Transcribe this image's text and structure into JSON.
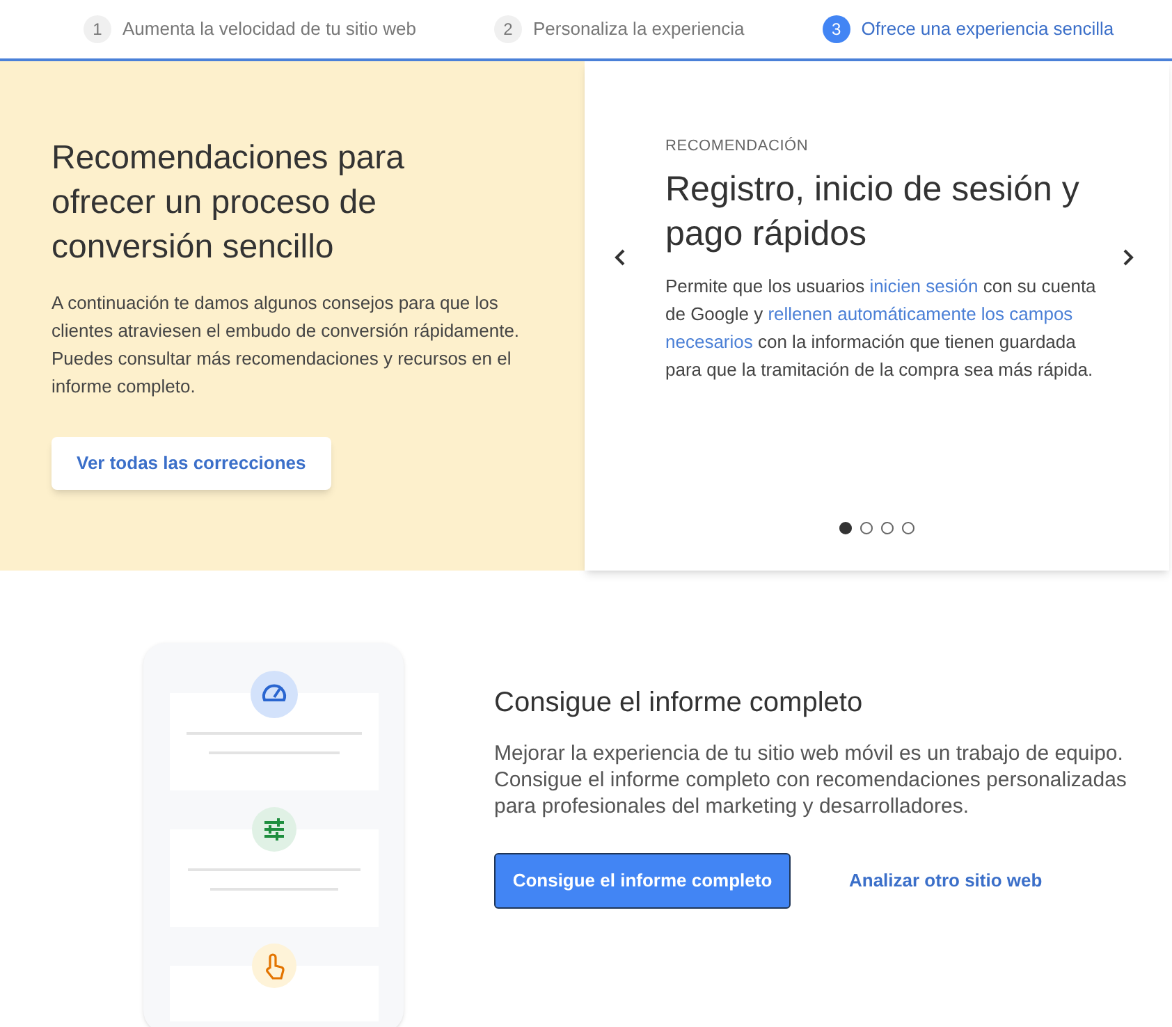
{
  "steps": [
    {
      "number": "1",
      "label": "Aumenta la velocidad de tu sitio web",
      "selected": false
    },
    {
      "number": "2",
      "label": "Personaliza la experiencia",
      "selected": false
    },
    {
      "number": "3",
      "label": "Ofrece una experiencia sencilla",
      "selected": true
    }
  ],
  "intro": {
    "title": "Recomendaciones para ofrecer un proceso de conversión sencillo",
    "text": "A continuación te damos algunos consejos para que los clientes atraviesen el embudo de conversión rápidamente. Puedes consultar más recomendaciones y recursos en el informe completo.",
    "button": "Ver todas las correcciones"
  },
  "recommendation": {
    "eyebrow": "RECOMENDACIÓN",
    "title": "Registro, inicio de sesión y pago rápidos",
    "segments": [
      {
        "kind": "text",
        "text": "Permite que los usuarios "
      },
      {
        "kind": "link",
        "text": "inicien sesión"
      },
      {
        "kind": "text",
        "text": " con su cuenta de Google y "
      },
      {
        "kind": "link",
        "text": "rellenen automáticamente los campos "
      },
      {
        "kind": "link",
        "text": "necesarios"
      },
      {
        "kind": "text",
        "text": " con la información que tienen guardada para que la tramitación de la compra sea más rápida."
      }
    ],
    "dots": [
      {
        "selected": true
      },
      {
        "selected": false
      },
      {
        "selected": false
      },
      {
        "selected": false
      }
    ]
  },
  "report": {
    "title": "Consigue el informe completo",
    "text": "Mejorar la experiencia de tu sitio web móvil es un trabajo de equipo. Consigue el informe completo con recomendaciones personalizadas para profesionales del marketing y desarrolladores.",
    "primary_button": "Consigue el informe completo",
    "link": "Analizar otro sitio web"
  }
}
